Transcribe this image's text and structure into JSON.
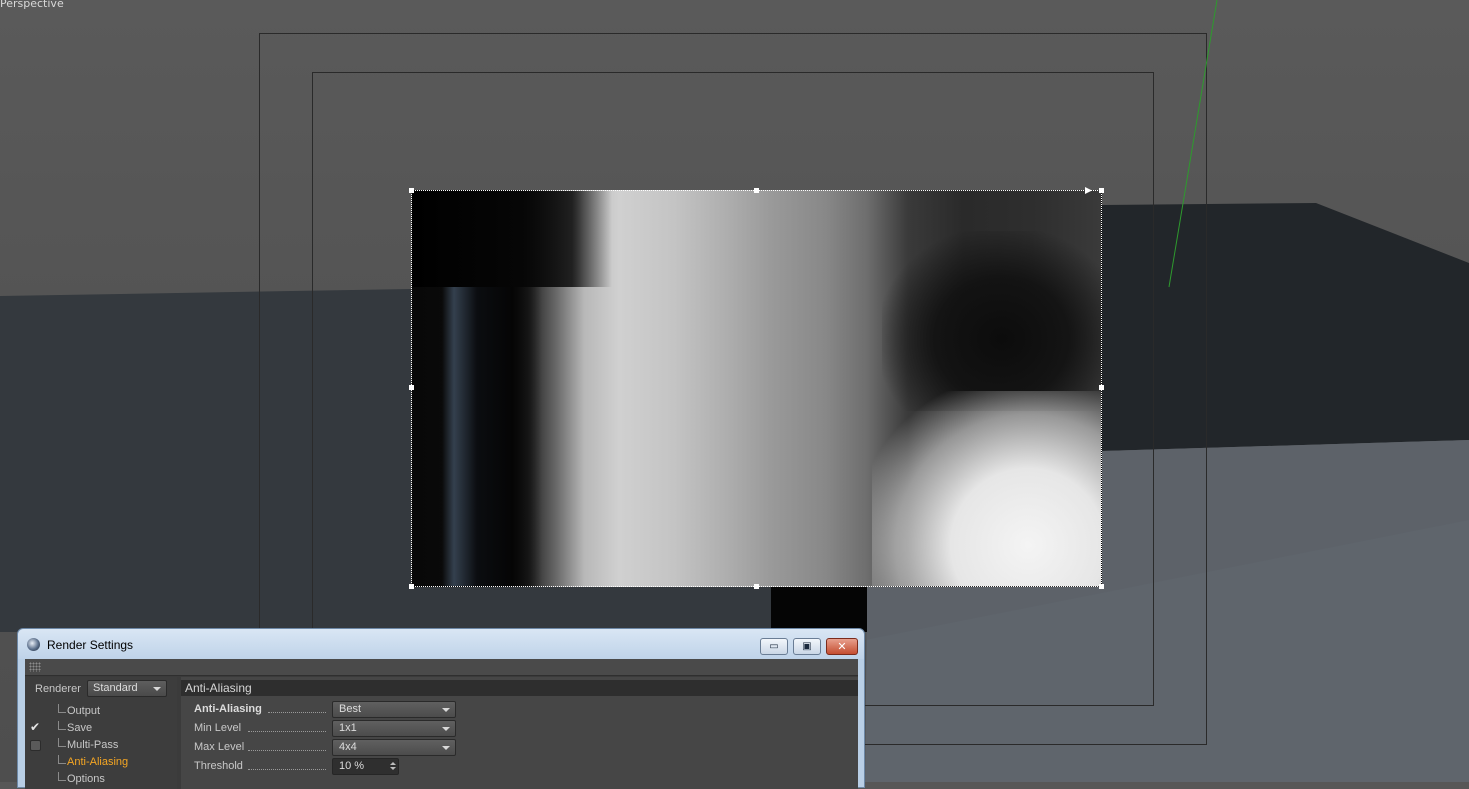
{
  "viewport": {
    "label": "Perspective"
  },
  "render_settings": {
    "title": "Render Settings",
    "window_buttons": {
      "minimize": "▭",
      "maximize": "▣",
      "close": "✕"
    },
    "renderer": {
      "label": "Renderer",
      "value": "Standard"
    },
    "tree": [
      {
        "label": "Output",
        "checkbox": "none"
      },
      {
        "label": "Save",
        "checkbox": "checked"
      },
      {
        "label": "Multi-Pass",
        "checkbox": "unchecked"
      },
      {
        "label": "Anti-Aliasing",
        "checkbox": "none",
        "active": true
      },
      {
        "label": "Options",
        "checkbox": "none"
      }
    ],
    "section_title": "Anti-Aliasing",
    "properties": {
      "anti_aliasing": {
        "label": "Anti-Aliasing",
        "value": "Best"
      },
      "min_level": {
        "label": "Min Level",
        "value": "1x1"
      },
      "max_level": {
        "label": "Max Level",
        "value": "4x4"
      },
      "threshold": {
        "label": "Threshold",
        "value": "10 %"
      }
    }
  },
  "colors": {
    "active_item": "#f5a623",
    "title_bar": "#c8dbf0",
    "close_button": "#c44d30"
  }
}
